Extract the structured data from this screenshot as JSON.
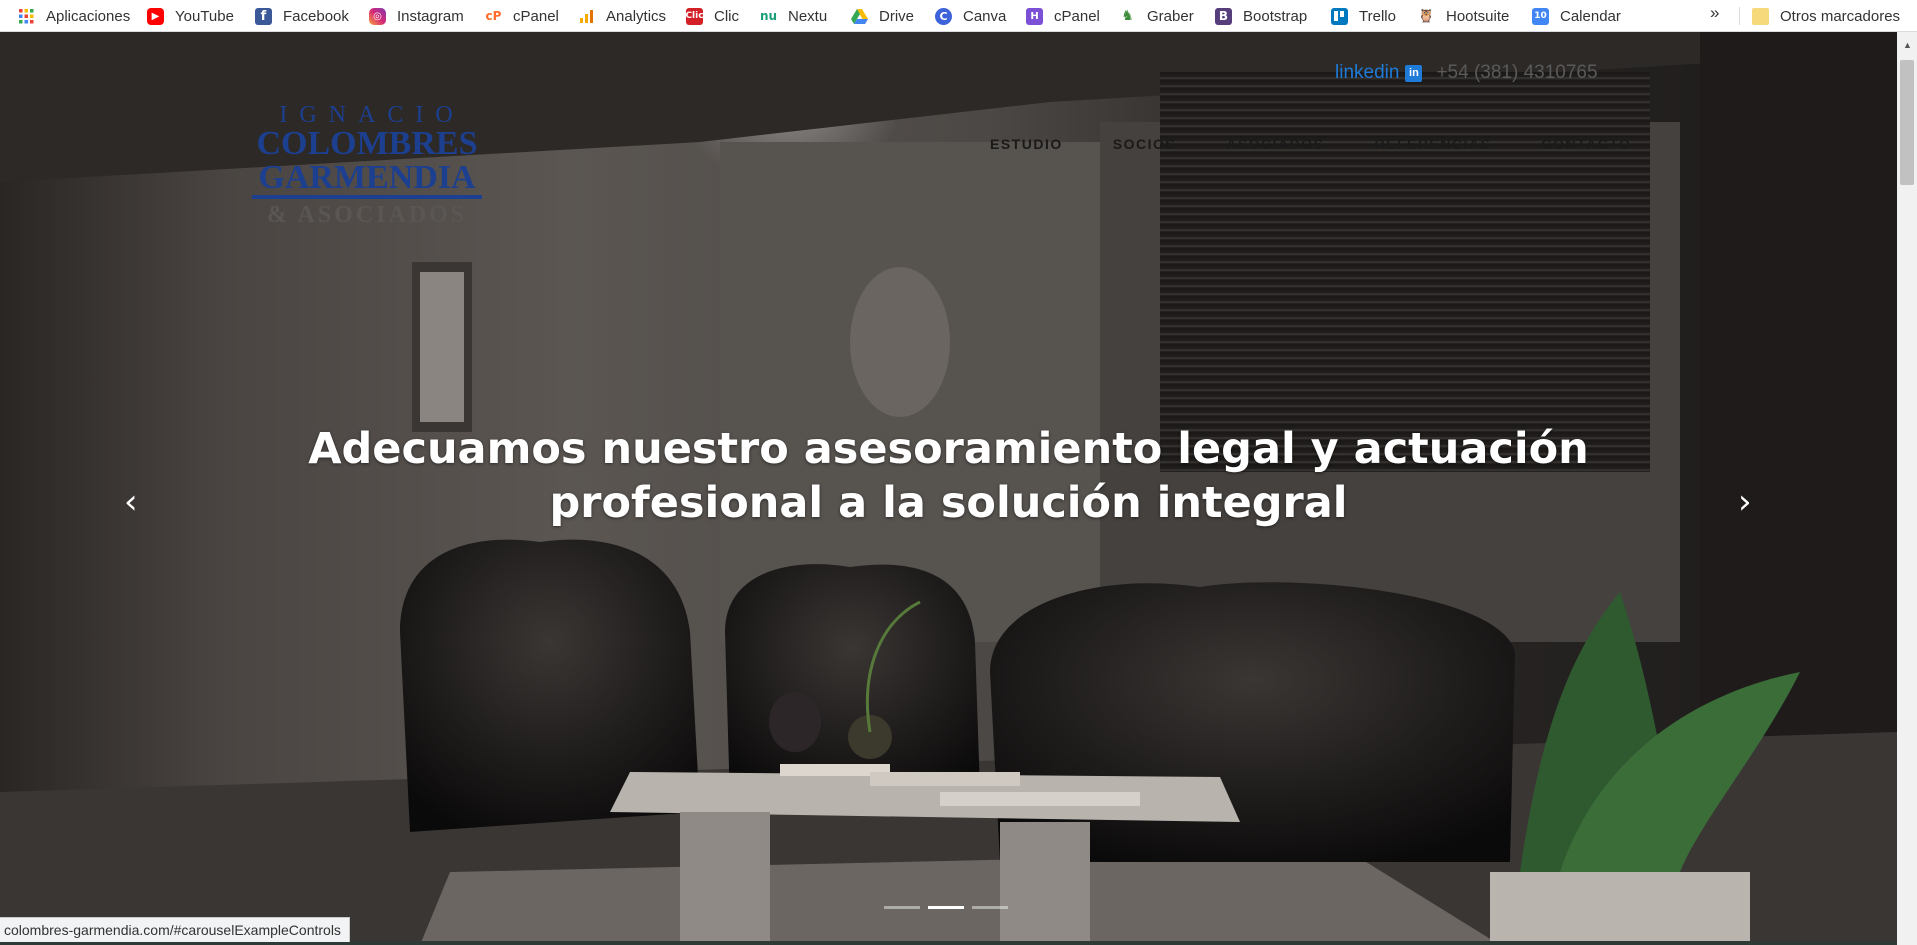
{
  "bookmarks": [
    {
      "label": "Aplicaciones",
      "icon": "apps-grid-icon"
    },
    {
      "label": "YouTube",
      "icon": "youtube-icon"
    },
    {
      "label": "Facebook",
      "icon": "facebook-icon"
    },
    {
      "label": "Instagram",
      "icon": "instagram-icon"
    },
    {
      "label": "cPanel",
      "icon": "cpanel-icon"
    },
    {
      "label": "Analytics",
      "icon": "analytics-icon"
    },
    {
      "label": "Clic",
      "icon": "clic-icon"
    },
    {
      "label": "Nextu",
      "icon": "nextu-icon"
    },
    {
      "label": "Drive",
      "icon": "drive-icon"
    },
    {
      "label": "Canva",
      "icon": "canva-icon"
    },
    {
      "label": "cPanel",
      "icon": "cpanel-alt-icon"
    },
    {
      "label": "Graber",
      "icon": "graber-icon"
    },
    {
      "label": "Bootstrap",
      "icon": "bootstrap-icon"
    },
    {
      "label": "Trello",
      "icon": "trello-icon"
    },
    {
      "label": "Hootsuite",
      "icon": "hootsuite-icon"
    },
    {
      "label": "Calendar",
      "icon": "calendar-icon"
    }
  ],
  "bookmarks_more": "»",
  "other_bookmarks": "Otros marcadores",
  "logo": {
    "line1": "IGNACIO",
    "line2": "COLOMBRES",
    "line3": "GARMENDIA",
    "line4": "& ASOCIADOS",
    "color": "#1c3f8f"
  },
  "contact": {
    "linkedin": "linkedin",
    "phone": "+54 (381) 4310765"
  },
  "nav": [
    "ESTUDIO",
    "SOCIOS",
    "ASOCIADOS",
    "REFERENCIAS",
    "CONTACTO"
  ],
  "hero": {
    "headline_line1": "Adecuamos nuestro asesoramiento legal y actuación",
    "headline_line2": "profesional a la solución integral",
    "prev": "‹",
    "next": "›",
    "slides": 3,
    "active_slide": 2
  },
  "status_url": "colombres-garmendia.com/#carouselExampleControls"
}
